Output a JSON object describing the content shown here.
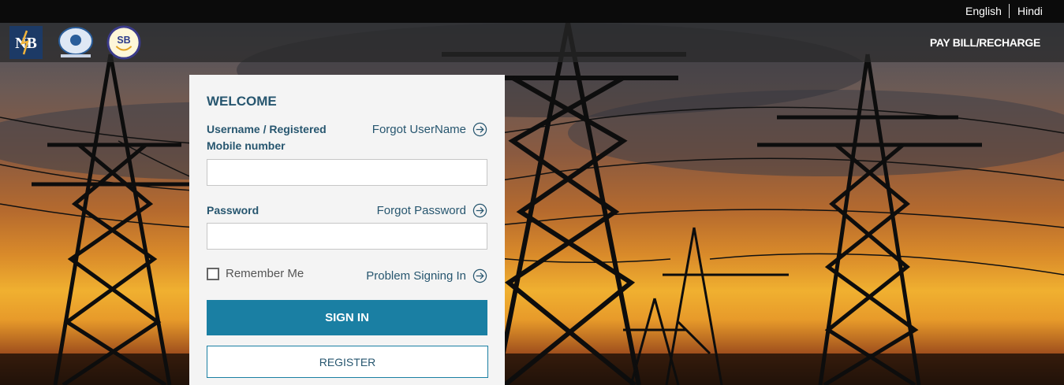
{
  "topbar": {
    "languages": [
      "English",
      "Hindi"
    ]
  },
  "header": {
    "logos": [
      "nb-logo",
      "government-emblem-logo",
      "sb-logo"
    ],
    "logo_texts": [
      "NB",
      "SB"
    ],
    "pay_bill_label": "PAY BILL/RECHARGE"
  },
  "login": {
    "title": "WELCOME",
    "username_label": "Username / Registered Mobile number",
    "forgot_username": "Forgot UserName",
    "username_value": "",
    "password_label": "Password",
    "forgot_password": "Forgot Password",
    "password_value": "",
    "remember_me": "Remember Me",
    "remember_checked": false,
    "problem_signing_in": "Problem Signing In",
    "sign_in_button": "SIGN IN",
    "register_button": "REGISTER"
  },
  "colors": {
    "accent": "#1a7fa3",
    "text_primary": "#27566f",
    "panel_bg": "#f4f4f4",
    "topbar_bg": "#0b0b0b"
  },
  "icons": {
    "link_arrow": "arrow-right-circle-icon"
  }
}
